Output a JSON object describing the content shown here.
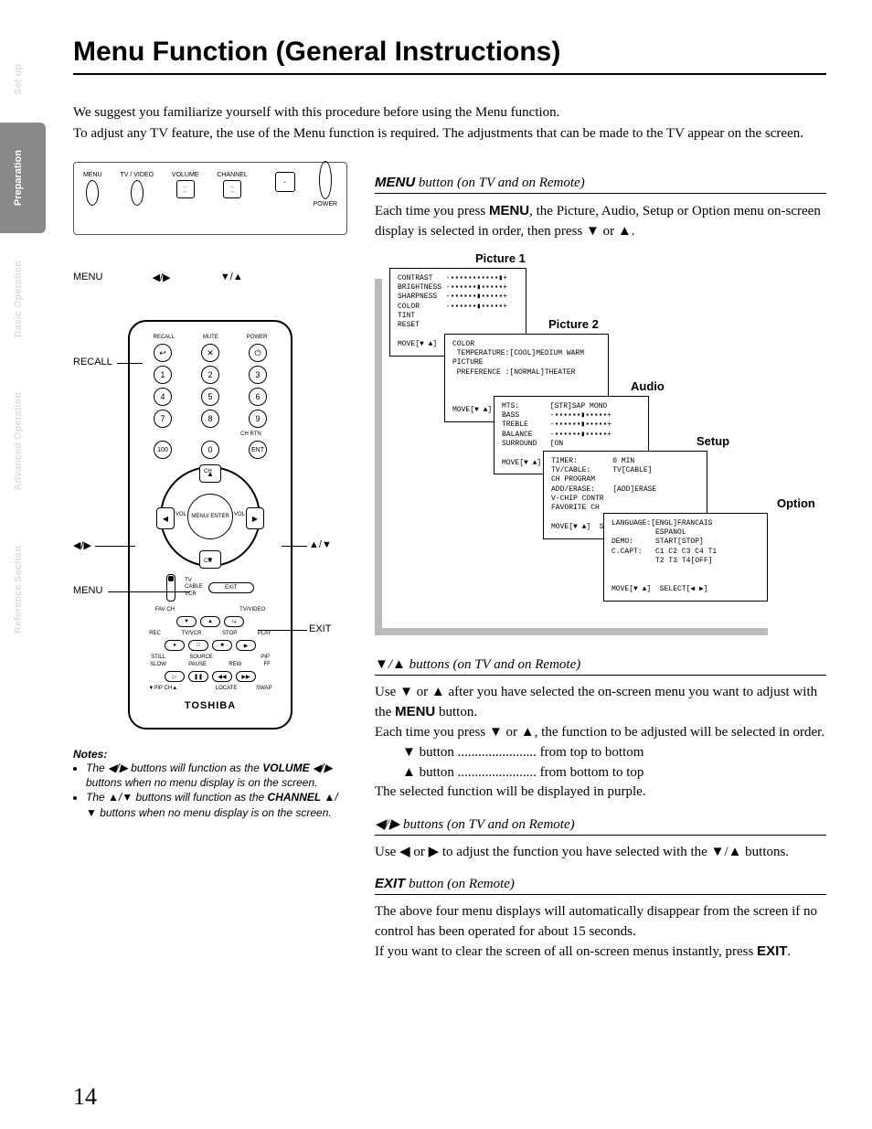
{
  "sideTabs": [
    "Set up",
    "Preparation",
    "Basic Operation",
    "Advanced Operation",
    "Reference Section"
  ],
  "activeTabIndex": 1,
  "title": "Menu Function (General Instructions)",
  "intro": [
    "We suggest you familiarize yourself with this procedure before using the Menu function.",
    "To adjust any TV feature, the use of the Menu function is required. The adjustments that can be made to the TV appear on the screen."
  ],
  "tvPanel": {
    "buttons": [
      "MENU",
      "TV / VIDEO",
      "VOLUME",
      "CHANNEL",
      "POWER"
    ],
    "bottomLabels": [
      "MENU",
      "◀/▶",
      "▼/▲"
    ]
  },
  "remote": {
    "topRowLabels": [
      "RECALL",
      "MUTE",
      "POWER"
    ],
    "topRowIcons": [
      "↩",
      "✕",
      "⏻"
    ],
    "numpad": [
      [
        "1",
        "2",
        "3"
      ],
      [
        "4",
        "5",
        "6"
      ],
      [
        "7",
        "8",
        "9"
      ],
      [
        "100",
        "0",
        "ENT"
      ]
    ],
    "chRtn": "CH RTN",
    "dpad": {
      "up": "CH",
      "down": "CH",
      "left": "VOL",
      "right": "VOL",
      "center": "MENU/\nENTER"
    },
    "switchLabels": [
      "TV",
      "CABLE",
      "VCR"
    ],
    "exit": "EXIT",
    "row1Labels": [
      "FAV CH",
      "",
      "TV/VIDEO"
    ],
    "row1Icons": [
      "▼",
      "▲",
      "↪"
    ],
    "row2Labels": [
      "REC",
      "TV/VCR",
      "STOP",
      "PLAY"
    ],
    "row2Icons": [
      "●",
      "□",
      "■",
      "▶"
    ],
    "row2bLabels": [
      "STILL",
      "SOURCE",
      "",
      "PIP"
    ],
    "row3Labels": [
      "SLOW",
      "PAUSE",
      "REW",
      "FF"
    ],
    "row3Icons": [
      "▷",
      "❚❚",
      "◀◀",
      "▶▶"
    ],
    "row3bLabels": [
      "▼PIP CH▲",
      "",
      "LOCATE",
      "SWAP"
    ],
    "brand": "TOSHIBA"
  },
  "callouts": {
    "menu1": "MENU",
    "recall": "RECALL",
    "lr": "◀/▶",
    "ud": "▲/▼",
    "menu2": "MENU",
    "exit": "EXIT"
  },
  "notes": {
    "heading": "Notes:",
    "items": [
      {
        "pre": "The ",
        "sym": "◀/▶",
        "mid": " buttons will function as the ",
        "kw": "VOLUME",
        "post": " ◀/▶ buttons when no menu display is on the screen."
      },
      {
        "pre": "The ",
        "sym": "▲/▼",
        "mid": " buttons will function as the ",
        "kw": "CHANNEL",
        "post": " ▲/▼ buttons when no menu display is on the screen."
      }
    ]
  },
  "sections": {
    "menu": {
      "headKw": "MENU",
      "headRest": " button (on TV and on Remote)",
      "p1a": "Each time you press ",
      "p1kw": "MENU",
      "p1b": ", the Picture, Audio, Setup or Option menu on-screen display is selected in order, then press ▼ or ▲."
    },
    "ud": {
      "head": "▼/▲ buttons (on TV and on Remote)",
      "p1a": "Use ▼ or ▲ after you have selected the on-screen menu you want to adjust with the ",
      "p1kw": "MENU",
      "p1b": " button.",
      "p2": "Each time you press ▼ or ▲, the function to be adjusted will be selected in order.",
      "li1": "▼ button ....................... from top to bottom",
      "li2": "▲ button ....................... from bottom to top",
      "p3": "The selected function will be displayed in purple."
    },
    "lr": {
      "head": "◀/▶ buttons (on TV and on Remote)",
      "p": "Use ◀ or ▶ to adjust the function you have selected with the ▼/▲ buttons."
    },
    "exit": {
      "headKw": "EXIT",
      "headRest": " button (on Remote)",
      "p1": "The above four menu displays will automatically disappear from the screen if no control has been operated for about 15 seconds.",
      "p2a": "If you want to clear the screen of all on-screen menus instantly, press ",
      "p2kw": "EXIT",
      "p2b": "."
    }
  },
  "osd": {
    "titles": [
      "Picture 1",
      "Picture 2",
      "Audio",
      "Setup",
      "Option"
    ],
    "picture1": "CONTRAST   -▪▪▪▪▪▪▪▪▪▪▪▮+\nBRIGHTNESS -▪▪▪▪▪▪▮▪▪▪▪▪+\nSHARPNESS  -▪▪▪▪▪▪▮▪▪▪▪▪+\nCOLOR      -▪▪▪▪▪▪▮▪▪▪▪▪+\nTINT\nRESET\n\nMOVE[▼ ▲]  A",
    "picture2": "COLOR\n TEMPERATURE:[COOL]MEDIUM WARM\nPICTURE\n PREFERENCE :[NORMAL]THEATER\n\n\n\nMOVE[▼ ▲]  SELE",
    "audio": "MTS:       [STR]SAP MONO\nBASS       -▪▪▪▪▪▪▮▪▪▪▪▪+\nTREBLE     -▪▪▪▪▪▪▮▪▪▪▪▪+\nBALANCE    -▪▪▪▪▪▪▮▪▪▪▪▪+\nSURROUND   [ON\n\nMOVE[▼ ▲]  SELEC",
    "setup": "TIMER:        0 MIN\nTV/CABLE:     TV[CABLE]\nCH PROGRAM\nADD/ERASE:    [ADD]ERASE\nV-CHIP CONTR\nFAVORITE CH\n\nMOVE[▼ ▲]  SEL",
    "option": "LANGUAGE:[ENGL]FRANCAIS\n          ESPANOL\nDEMO:     START[STOP]\nC.CAPT:   C1 C2 C3 C4 T1\n          T2 T3 T4[OFF]\n\n\nMOVE[▼ ▲]  SELECT[◀ ▶]"
  },
  "pageNumber": "14"
}
